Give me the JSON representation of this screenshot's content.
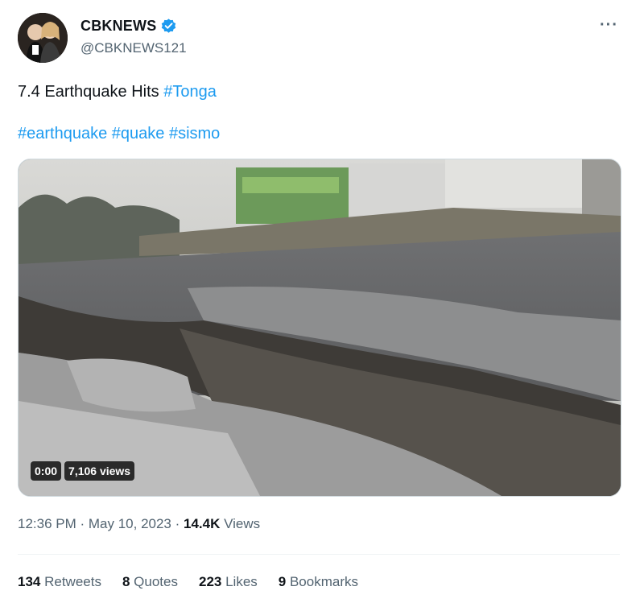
{
  "author": {
    "display_name": "CBKNEWS",
    "handle": "@CBKNEWS121",
    "verified_color": "#1d9bf0"
  },
  "icons": {
    "verified": "verified-badge-icon",
    "more": "more-options-icon"
  },
  "more_label": "···",
  "tweet": {
    "line1_text": "7.4 Earthquake Hits ",
    "line1_hashtag": "#Tonga",
    "hashtags": [
      "#earthquake",
      "#quake",
      "#sismo"
    ]
  },
  "video": {
    "time": "0:00",
    "views": "7,106 views"
  },
  "meta": {
    "time": "12:36 PM",
    "separator": " · ",
    "date": "May 10, 2023",
    "views_count": "14.4K",
    "views_label": " Views"
  },
  "stats": [
    {
      "count": "134",
      "label": " Retweets"
    },
    {
      "count": "8",
      "label": " Quotes"
    },
    {
      "count": "223",
      "label": " Likes"
    },
    {
      "count": "9",
      "label": " Bookmarks"
    }
  ]
}
